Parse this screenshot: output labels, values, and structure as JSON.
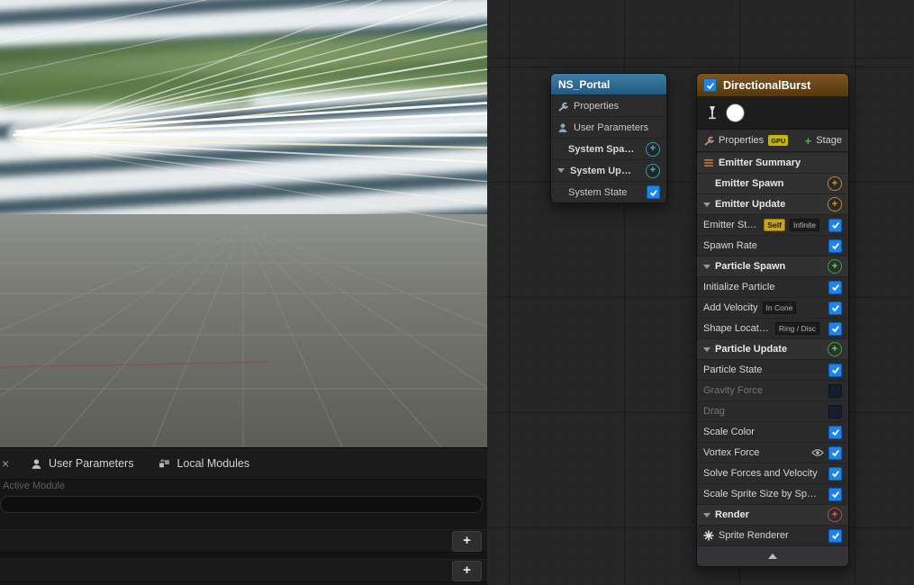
{
  "glyphs": {
    "plus": "+",
    "close": "×"
  },
  "bottom_panel": {
    "tabs": [
      {
        "label": "User Parameters"
      },
      {
        "label": "Local Modules"
      }
    ],
    "active_module": "Active Module"
  },
  "system_node": {
    "title": "NS_Portal",
    "rows": [
      {
        "label": "Properties"
      },
      {
        "label": "User Parameters"
      },
      {
        "label": "System Spawn",
        "has_add": true
      },
      {
        "label": "System Update",
        "has_add": true,
        "collapsed": false
      },
      {
        "label": "System State",
        "checked": true
      }
    ]
  },
  "emitter_node": {
    "title": "DirectionalBurst",
    "toolbar": {
      "properties": "Properties",
      "gpu_badge": "GPU",
      "stage": "Stage"
    },
    "rows": [
      {
        "label": "Emitter Summary",
        "type": "summary"
      },
      {
        "label": "Emitter Spawn",
        "type": "group",
        "add_color": "amber"
      },
      {
        "label": "Emitter Update",
        "type": "group",
        "add_color": "amber",
        "collapsed": false
      },
      {
        "label": "Emitter State",
        "badges": [
          "Self",
          "Infinite"
        ],
        "checked": true
      },
      {
        "label": "Spawn Rate",
        "checked": true
      },
      {
        "label": "Particle Spawn",
        "type": "group",
        "add_color": "green",
        "collapsed": false
      },
      {
        "label": "Initialize Particle",
        "checked": true
      },
      {
        "label": "Add Velocity",
        "badges": [
          "In Cone"
        ],
        "checked": true
      },
      {
        "label": "Shape Location",
        "badges": [
          "Ring / Disc"
        ],
        "checked": true
      },
      {
        "label": "Particle Update",
        "type": "group",
        "add_color": "green",
        "collapsed": false
      },
      {
        "label": "Particle State",
        "checked": true
      },
      {
        "label": "Gravity Force",
        "checked": false,
        "disabled": true
      },
      {
        "label": "Drag",
        "checked": false,
        "disabled": true
      },
      {
        "label": "Scale Color",
        "checked": true
      },
      {
        "label": "Vortex Force",
        "checked": true,
        "has_eye": true
      },
      {
        "label": "Solve Forces and Velocity",
        "checked": true
      },
      {
        "label": "Scale Sprite Size by Speed",
        "checked": true
      },
      {
        "label": "Render",
        "type": "group",
        "add_color": "red",
        "collapsed": false
      },
      {
        "label": "Sprite Renderer",
        "checked": true,
        "icon": "sprite"
      }
    ]
  }
}
